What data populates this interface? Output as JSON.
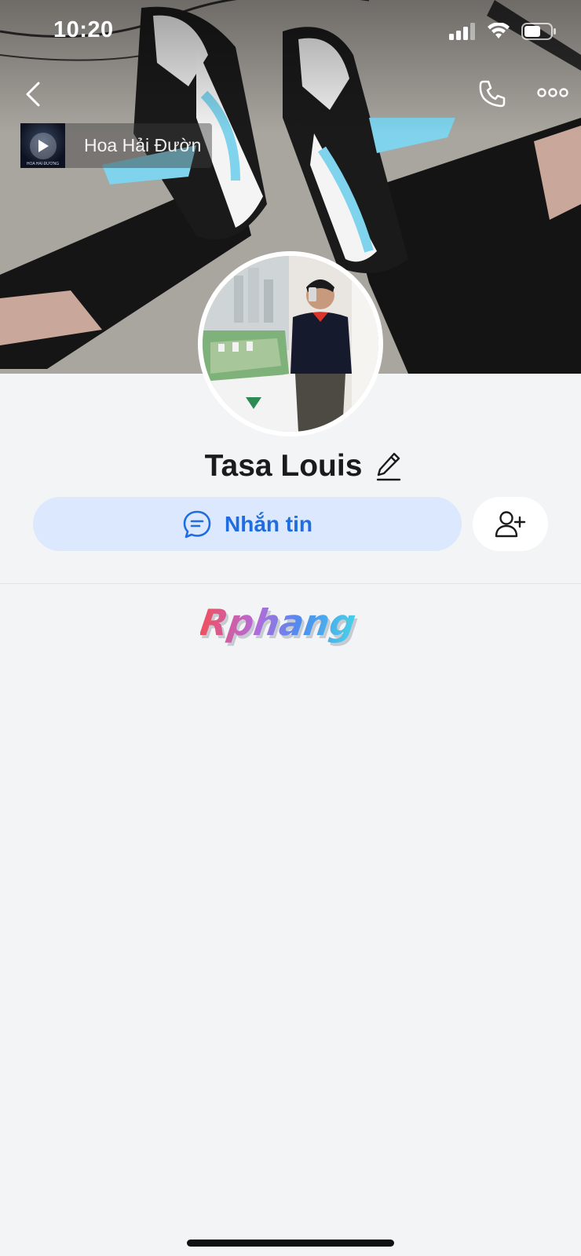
{
  "status_bar": {
    "time": "10:20"
  },
  "music": {
    "title": "Hoa Hải Đườn",
    "thumb_text": "HOA HẢI ĐƯỜNG"
  },
  "profile": {
    "name": "Tasa Louis",
    "cover_icon": "cover-photo",
    "avatar_icon": "avatar-photo"
  },
  "actions": {
    "message_label": "Nhắn tin",
    "message_icon": "chat-bubble-icon",
    "add_friend_icon": "add-user-icon"
  },
  "watermark": {
    "text": "Rphang"
  },
  "colors": {
    "accent": "#1f6de0",
    "message_bg": "#dce8fd",
    "background": "#f3f4f6",
    "text": "#1b1b1b"
  }
}
